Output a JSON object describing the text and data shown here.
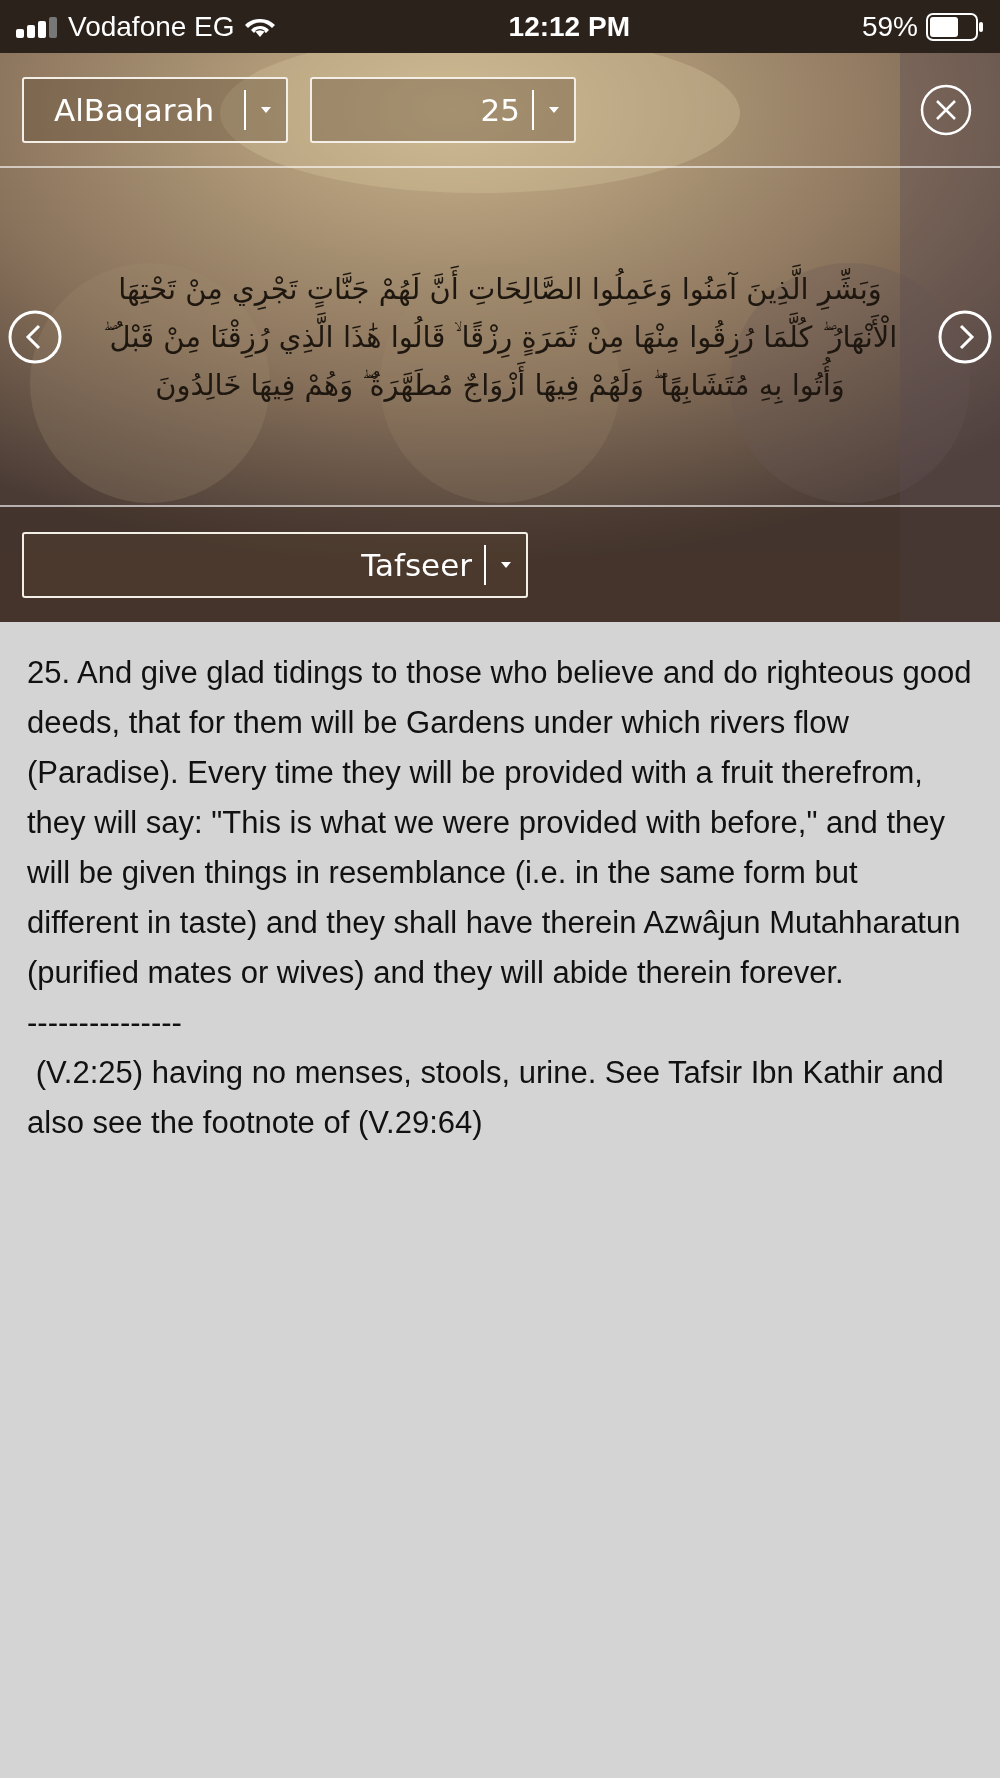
{
  "status_bar": {
    "carrier": "Vodafone EG",
    "time": "12:12 PM",
    "battery": "59%"
  },
  "header": {
    "surah_dropdown": {
      "value": "AlBaqarah"
    },
    "ayah_dropdown": {
      "value": "25"
    },
    "verse": "وَبَشِّرِ الَّذِينَ آمَنُوا وَعَمِلُوا الصَّالِحَاتِ أَنَّ لَهُمْ جَنَّاتٍ تَجْرِي مِنْ تَحْتِهَا الْأَنْهَارُ ۖ كُلَّمَا رُزِقُوا مِنْهَا مِنْ ثَمَرَةٍ رِزْقًا ۙ قَالُوا هَٰذَا الَّذِي رُزِقْنَا مِنْ قَبْلُ ۖ وَأُتُوا بِهِ مُتَشَابِهًا ۖ وَلَهُمْ فِيهَا أَزْوَاجٌ مُطَهَّرَةٌ ۖ وَهُمْ فِيهَا خَالِدُونَ",
    "tafseer_dropdown": {
      "value": "Tafseer"
    }
  },
  "content": {
    "paragraphs": [
      "25. And give glad tidings to those who believe and do righteous good deeds, that for them will be Gardens under which rivers flow (Paradise). Every time they will be provided with a fruit therefrom, they will say: \"This is what we were provided with before,\" and they will be given things in resemblance (i.e. in the same form but different in taste) and they shall have therein Azwâjun Mutahharatun (purified mates or wives) and they will abide therein forever.",
      "---------------",
      " (V.2:25) having no menses, stools, urine. See Tafsir Ibn Kathir and also see the footnote of (V.29:64)"
    ]
  }
}
